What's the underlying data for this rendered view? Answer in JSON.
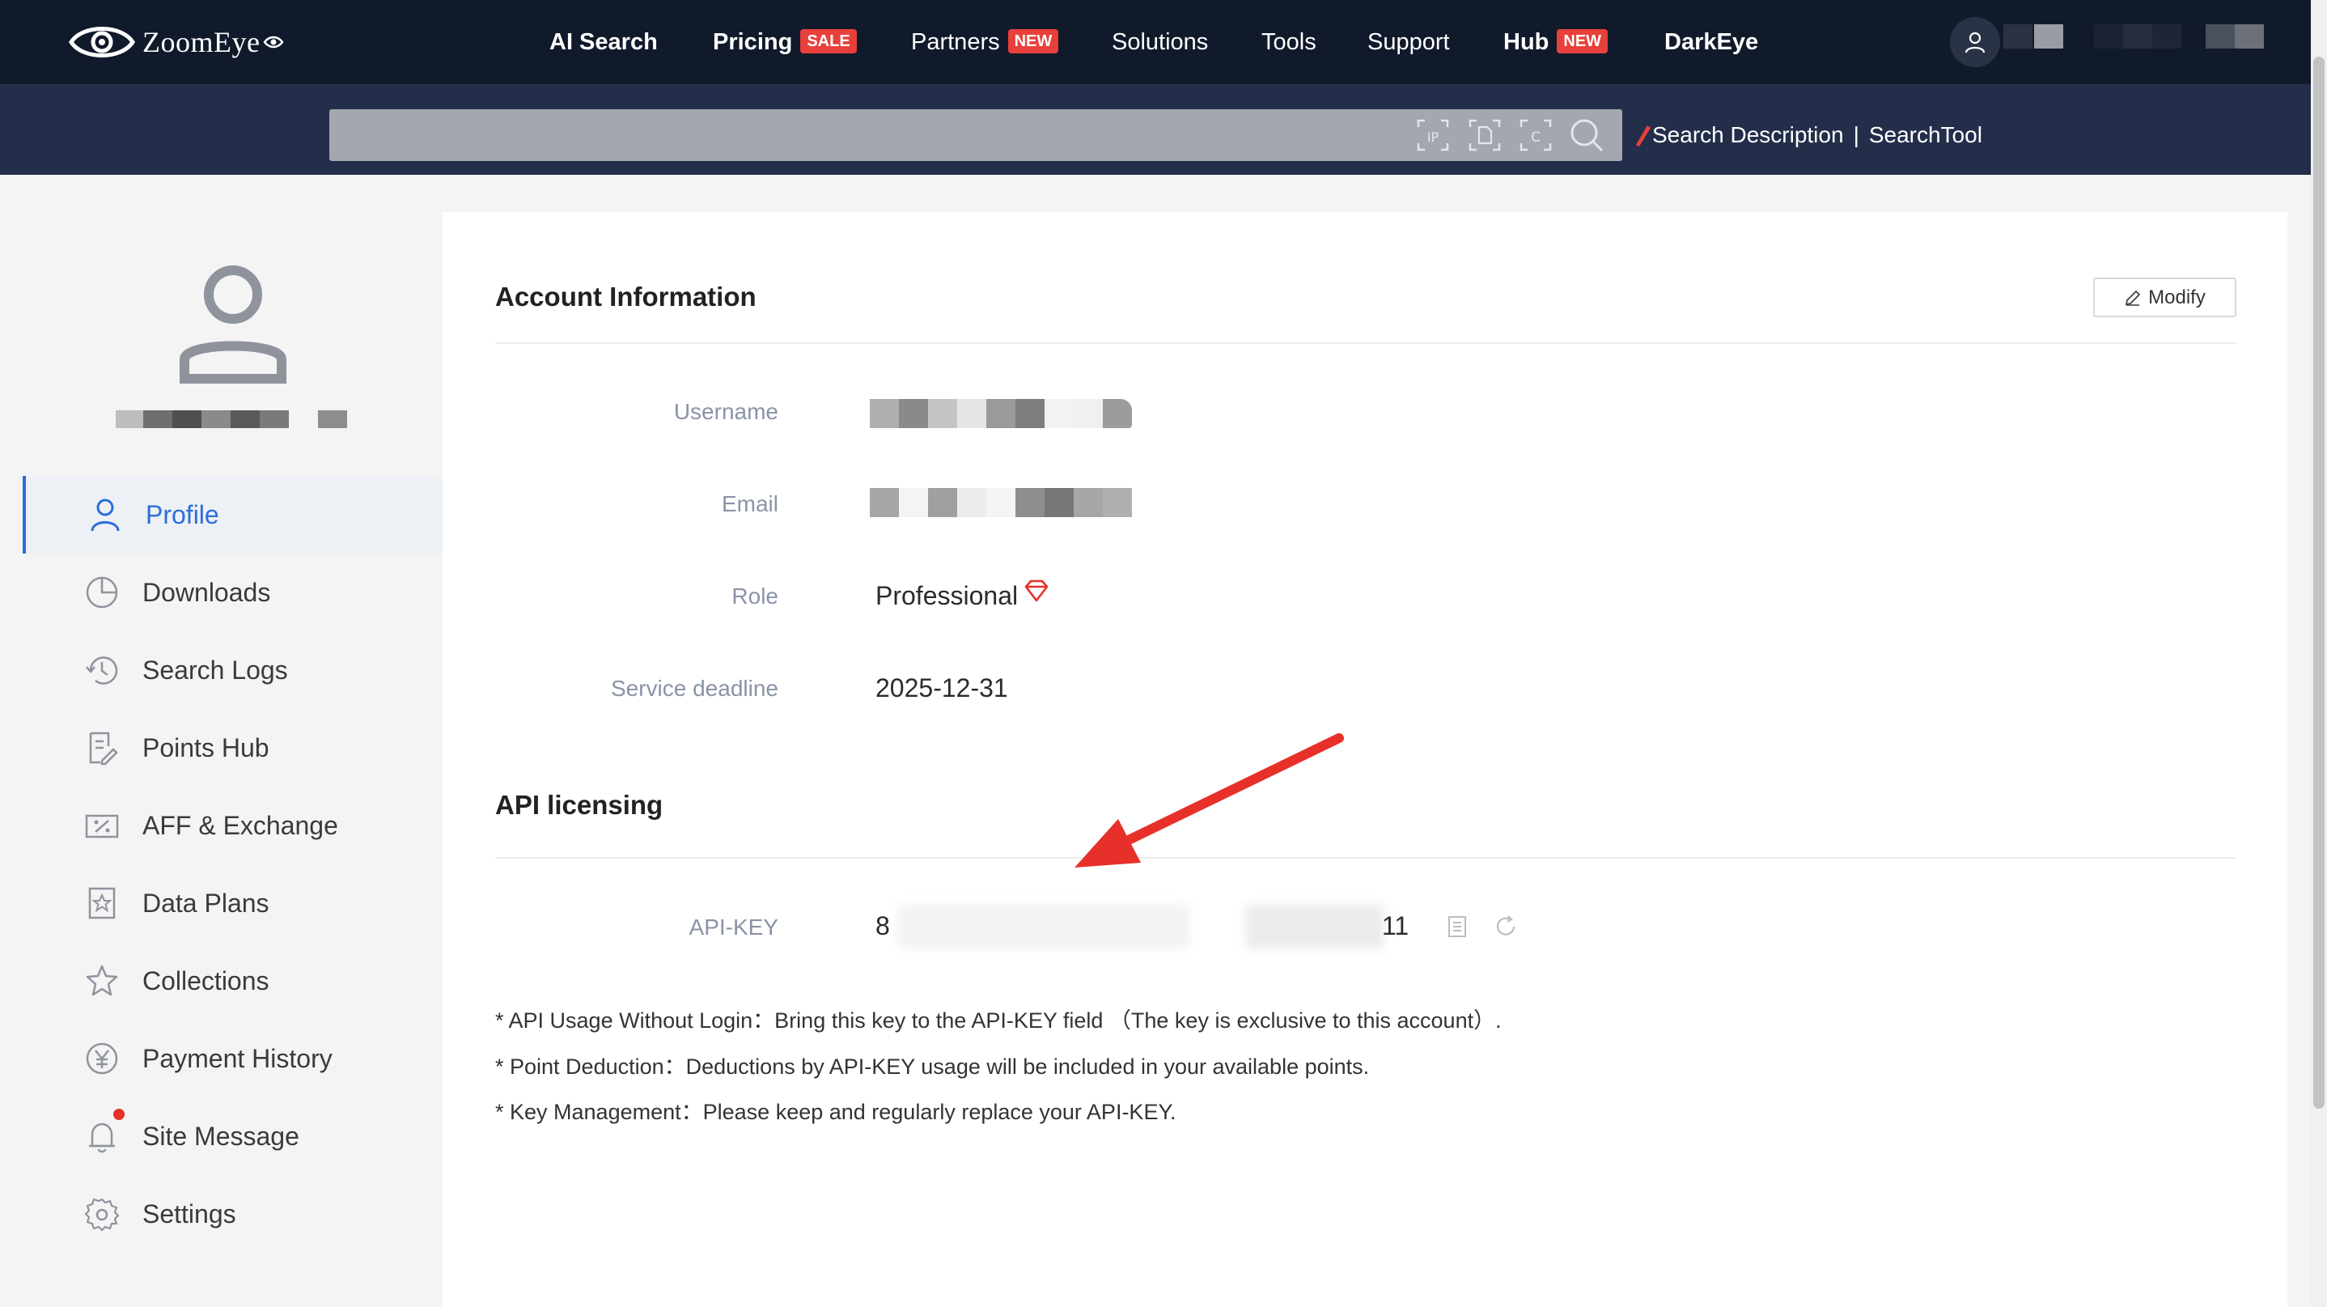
{
  "nav": {
    "logo": "ZoomEye",
    "items": [
      {
        "label": "AI Search",
        "bold": true
      },
      {
        "label": "Pricing",
        "bold": true,
        "badge": "SALE"
      },
      {
        "label": "Partners",
        "bold": false,
        "badge": "NEW"
      },
      {
        "label": "Solutions",
        "bold": false
      },
      {
        "label": "Tools",
        "bold": false
      },
      {
        "label": "Support",
        "bold": false
      },
      {
        "label": "Hub",
        "bold": true,
        "badge": "NEW"
      },
      {
        "label": "DarkEye",
        "bold": true
      }
    ]
  },
  "search": {
    "value": "",
    "description_link": "Search Description",
    "separator": "|",
    "tool_link": "SearchTool",
    "icons": [
      "ip-scan-icon",
      "domain-scan-icon",
      "cert-scan-icon",
      "search-icon"
    ]
  },
  "sidebar": {
    "items": [
      {
        "label": "Profile",
        "icon": "user-icon",
        "active": true
      },
      {
        "label": "Downloads",
        "icon": "pie-chart-icon"
      },
      {
        "label": "Search Logs",
        "icon": "history-icon"
      },
      {
        "label": "Points Hub",
        "icon": "edit-document-icon"
      },
      {
        "label": "AFF & Exchange",
        "icon": "ticket-icon"
      },
      {
        "label": "Data Plans",
        "icon": "bookmark-star-icon"
      },
      {
        "label": "Collections",
        "icon": "star-icon"
      },
      {
        "label": "Payment History",
        "icon": "yen-circle-icon"
      },
      {
        "label": "Site Message",
        "icon": "bell-icon",
        "unread_dot": true
      },
      {
        "label": "Settings",
        "icon": "gear-icon"
      }
    ]
  },
  "account": {
    "title": "Account Information",
    "modify_label": "Modify",
    "fields": {
      "username_label": "Username",
      "email_label": "Email",
      "role_label": "Role",
      "role_value": "Professional",
      "deadline_label": "Service deadline",
      "deadline_value": "2025-12-31"
    }
  },
  "api": {
    "title": "API licensing",
    "key_label": "API-KEY",
    "key_prefix": "8",
    "key_suffix": "11",
    "notes": [
      "* API Usage Without Login：Bring this key to the API-KEY field （The key is exclusive to this account）.",
      "* Point Deduction：Deductions by API-KEY usage will be included in your available points.",
      "* Key Management：Please keep and regularly replace your API-KEY."
    ]
  },
  "colors": {
    "nav_bg": "#111a2b",
    "search_band_bg": "#232e4a",
    "accent_blue": "#2a6fd9",
    "badge_red": "#e8403a",
    "annotation_arrow": "#e8302a"
  }
}
